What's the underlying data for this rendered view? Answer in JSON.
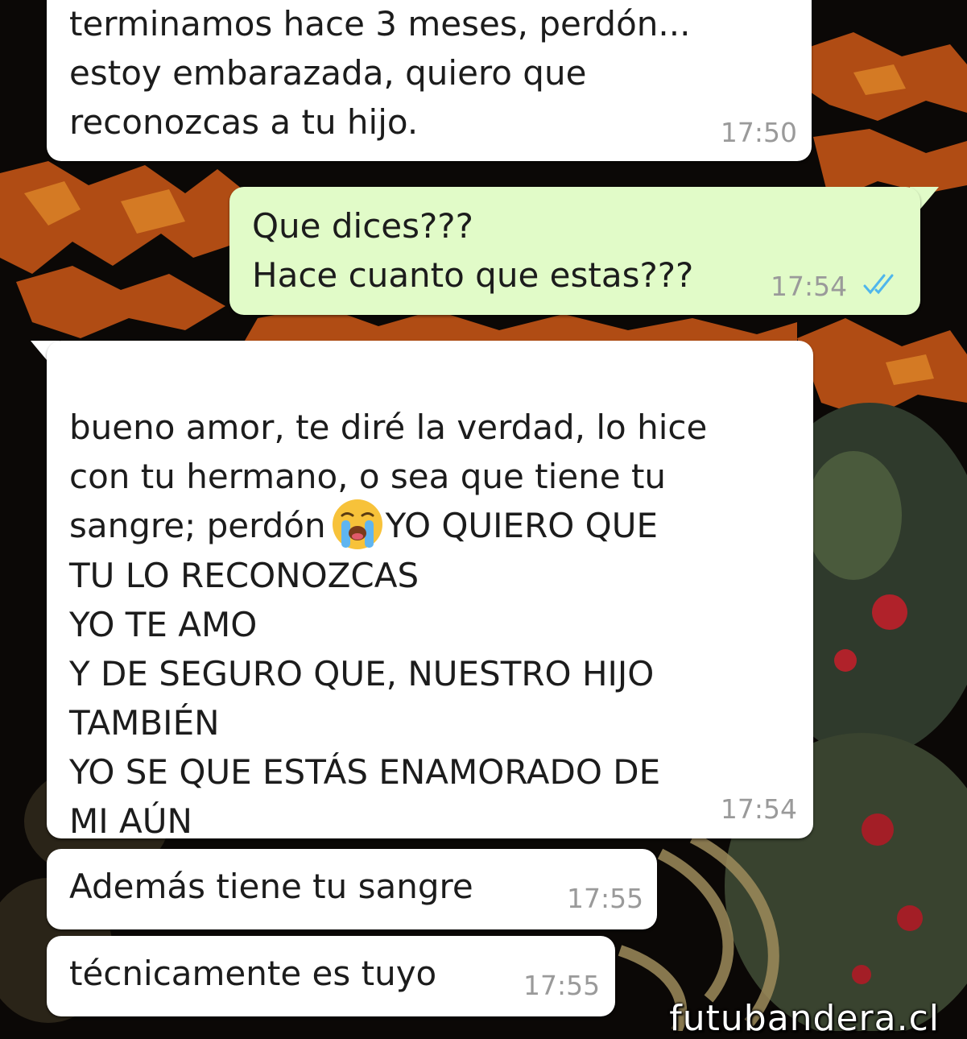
{
  "chat": {
    "messages": [
      {
        "id": "m1",
        "direction": "incoming",
        "text": "terminamos hace 3 meses, perdón...\nestoy embarazada, quiero que\nreconozcas a tu hijo.",
        "time": "17:50"
      },
      {
        "id": "m2",
        "direction": "outgoing",
        "text": "Que dices???\nHace cuanto que estas???",
        "time": "17:54",
        "status": "read"
      },
      {
        "id": "m3",
        "direction": "incoming",
        "text_before_emoji": "bueno amor, te diré la verdad, lo hice\ncon tu hermano, o sea que tiene tu\nsangre; perdón",
        "emoji": "loudly-crying-face",
        "text_after_emoji": "YO QUIERO QUE\nTU LO RECONOZCAS\nYO TE AMO\nY DE SEGURO QUE, NUESTRO HIJO\nTAMBIÉN\nYO SE QUE ESTÁS ENAMORADO DE\nMI AÚN",
        "time": "17:54"
      },
      {
        "id": "m4",
        "direction": "incoming",
        "text": "Además tiene tu sangre",
        "time": "17:55"
      },
      {
        "id": "m5",
        "direction": "incoming",
        "text": "técnicamente es tuyo",
        "time": "17:55"
      }
    ]
  },
  "watermark": "futubandera.cl",
  "colors": {
    "incoming_bubble": "#ffffff",
    "outgoing_bubble": "#e1fbc8",
    "read_ticks": "#4fb6ec",
    "timestamp": "#9a9a9a"
  }
}
